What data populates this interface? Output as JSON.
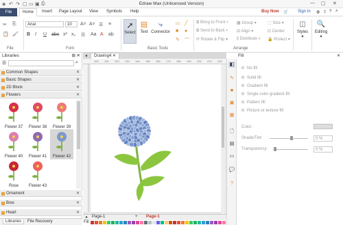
{
  "window": {
    "title": "Edraw Max (Unlicensed Version)"
  },
  "menu": {
    "tabs": [
      "File",
      "Home",
      "Insert",
      "Page Layout",
      "View",
      "Symbols",
      "Help"
    ],
    "buy_now": "Buy Now",
    "sign_in": "Sign In"
  },
  "ribbon": {
    "font_name": "Arial",
    "font_size": "10",
    "groups": {
      "file": "File",
      "font": "Font",
      "basic_tools": "Basic Tools",
      "arrange": "Arrange"
    },
    "tools": {
      "select": "Select",
      "text": "Text",
      "connector": "Connector"
    },
    "arrange": {
      "bring_front": "Bring to Front",
      "send_back": "Send to Back",
      "rotate_flip": "Rotate & Flip",
      "group": "Group",
      "align": "Align",
      "distribute": "Distribute",
      "size": "Size",
      "center": "Center",
      "protect": "Protect"
    },
    "styles": "Styles",
    "editing": "Editing"
  },
  "libraries": {
    "header": "Libraries",
    "search_placeholder": "",
    "categories_top": [
      "Common Shapes",
      "Basic Shapes",
      "2D Block",
      "Flowers"
    ],
    "flowers": [
      {
        "label": "Flower 37",
        "color": "#d8304a"
      },
      {
        "label": "Flower 38",
        "color": "#e04a66"
      },
      {
        "label": "Flower 39",
        "color": "#ee7a7a"
      },
      {
        "label": "Flower 40",
        "color": "#d97fb2"
      },
      {
        "label": "Flower 41",
        "color": "#8c6bb5"
      },
      {
        "label": "Flower 42",
        "color": "#7c98cc"
      },
      {
        "label": "Rose",
        "color": "#c8253a"
      },
      {
        "label": "Flower 43",
        "color": "#ef5f5f"
      }
    ],
    "categories_bottom": [
      "Ornament",
      "Bow",
      "Heart"
    ],
    "bottom_tabs": [
      "Libraries",
      "File Recovery"
    ]
  },
  "document": {
    "tab": "Drawing4",
    "page_tabs": [
      "Page-1",
      "Page-1"
    ]
  },
  "ruler_marks": [
    "100",
    "110",
    "120",
    "130",
    "140",
    "150",
    "160",
    "170",
    "180",
    "190",
    "200",
    "210",
    "220"
  ],
  "fill_panel": {
    "title": "Fill",
    "options": [
      "No fill",
      "Solid fill",
      "Gradient fill",
      "Single color gradient fill",
      "Pattern fill",
      "Picture or texture fill"
    ],
    "color_label": "Color:",
    "shade_label": "Shade/Tint:",
    "shade_value": "0 %",
    "transparency_label": "Transparency:",
    "transparency_value": "0 %"
  },
  "bottom_fill": "Fill",
  "colors": {
    "file_tab": "#3b4d6e",
    "accent": "#c0392b",
    "flower_blue": "#7c98cc",
    "leaf": "#8cc63f"
  }
}
